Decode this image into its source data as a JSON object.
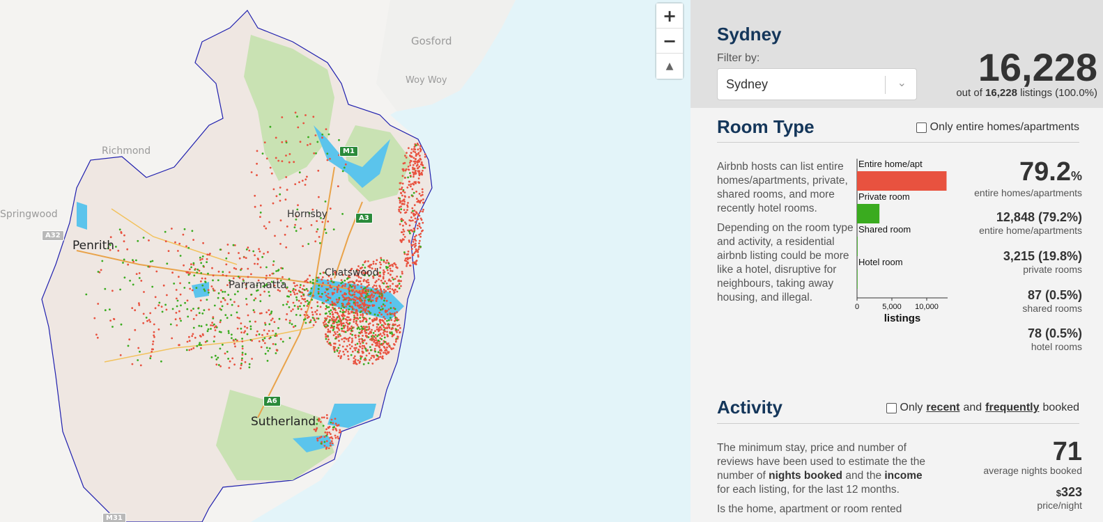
{
  "map": {
    "labels": {
      "gosford": "Gosford",
      "woy_woy": "Woy Woy",
      "richmond": "Richmond",
      "springwood": "Springwood",
      "penrith": "Penrith",
      "hornsby": "Hornsby",
      "chatswood": "Chatswood",
      "parramatta": "Parramatta",
      "sutherland": "Sutherland"
    },
    "shields": {
      "m1": "M1",
      "a3": "A3",
      "a32": "A32",
      "a6": "A6",
      "m31": "M31"
    },
    "controls": {
      "zoom_in": "+",
      "zoom_out": "−",
      "compass": "▲"
    },
    "colors": {
      "entire_home": "#e8523f",
      "private_room": "#3aab1f",
      "water": "#5bc4ec",
      "land": "#f0e9e4",
      "park": "#c9e2b3",
      "boundary": "#1f1fae"
    }
  },
  "header": {
    "city": "Sydney",
    "filter_label": "Filter by:",
    "filter_value": "Sydney",
    "total": "16,228",
    "out_of_prefix": "out of",
    "out_of_count": "16,228",
    "out_of_suffix": "listings (100.0%)"
  },
  "room_type": {
    "title": "Room Type",
    "checkbox_label": "Only entire homes/apartments",
    "para1": "Airbnb hosts can list entire homes/apartments, private, shared rooms, and more recently hotel rooms.",
    "para2": "Depending on the room type and activity, a residential airbnb listing could be more like a hotel, disruptive for neighbours, taking away housing, and illegal.",
    "headline_pct": "79.2",
    "headline_pct_sign": "%",
    "headline_label": "entire homes/apartments",
    "stats": [
      {
        "value": "12,848 (79.2%)",
        "label": "entire home/apartments"
      },
      {
        "value": "3,215 (19.8%)",
        "label": "private rooms"
      },
      {
        "value": "87 (0.5%)",
        "label": "shared rooms"
      },
      {
        "value": "78 (0.5%)",
        "label": "hotel rooms"
      }
    ]
  },
  "chart_data": {
    "type": "bar",
    "orientation": "horizontal",
    "categories": [
      "Entire home/apt",
      "Private room",
      "Shared room",
      "Hotel room"
    ],
    "values": [
      12848,
      3215,
      87,
      78
    ],
    "colors": [
      "#e8523f",
      "#3aab1f",
      "#3aab1f",
      "#3aab1f"
    ],
    "xlabel": "listings",
    "xticks": [
      "0",
      "5,000",
      "10,000"
    ],
    "xtick_values": [
      0,
      5000,
      10000
    ],
    "xlim": [
      0,
      13000
    ]
  },
  "activity": {
    "title": "Activity",
    "checkbox_prefix": "Only",
    "checkbox_recent": "recent",
    "checkbox_and": "and",
    "checkbox_frequently": "frequently",
    "checkbox_suffix": "booked",
    "para1_a": "The minimum stay, price and number of reviews have been used to estimate the the number of",
    "para1_b": "nights booked",
    "para1_c": "and the",
    "para1_d": "income",
    "para1_e": "for each listing, for the last 12 months.",
    "para2": "Is the home, apartment or room rented",
    "nights_value": "71",
    "nights_label": "average nights booked",
    "price_symbol": "$",
    "price_value": "323",
    "price_label": "price/night"
  }
}
